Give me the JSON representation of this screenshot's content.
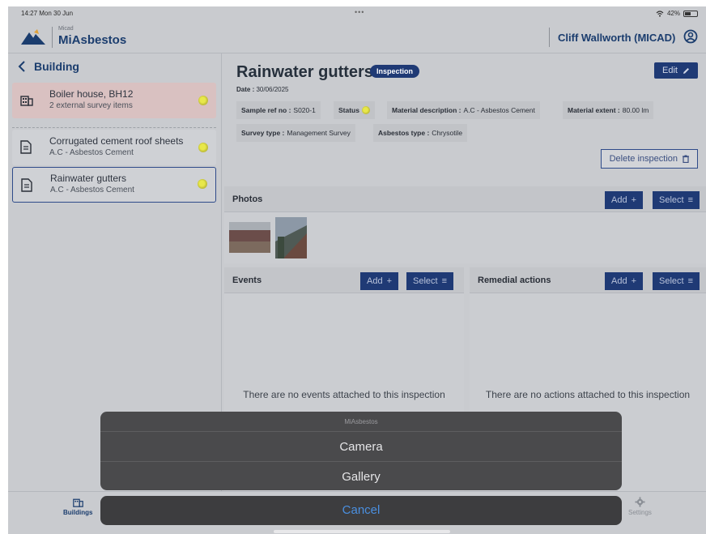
{
  "status_bar": {
    "time": "14:27  Mon 30 Jun",
    "dots": "•••",
    "battery": "42%"
  },
  "header": {
    "logo_small": "Micad",
    "logo_name": "MiAsbestos",
    "user_name": "Cliff Wallworth (MICAD)"
  },
  "sidebar": {
    "back_title": "Building",
    "items": [
      {
        "title": "Boiler house, BH12",
        "subtitle": "2 external survey items",
        "icon": "building-icon"
      },
      {
        "title": "Corrugated cement roof sheets",
        "subtitle": "A.C - Asbestos Cement",
        "icon": "document-icon"
      },
      {
        "title": "Rainwater gutters",
        "subtitle": "A.C - Asbestos Cement",
        "icon": "document-icon"
      }
    ]
  },
  "main": {
    "title": "Rainwater gutters",
    "badge": "Inspection",
    "edit_label": "Edit",
    "date_label": "Date :",
    "date_value": "30/06/2025",
    "sample_ref_label": "Sample ref no :",
    "sample_ref_value": "S020-1",
    "status_label": "Status",
    "material_desc_label": "Material description :",
    "material_desc_value": "A.C - Asbestos Cement",
    "material_extent_label": "Material extent :",
    "material_extent_value": "80.00 lm",
    "survey_type_label": "Survey type :",
    "survey_type_value": "Management Survey",
    "asbestos_type_label": "Asbestos type :",
    "asbestos_type_value": "Chrysotile",
    "delete_label": "Delete inspection",
    "photos": {
      "title": "Photos",
      "add_label": "Add",
      "select_label": "Select"
    },
    "events": {
      "title": "Events",
      "add_label": "Add",
      "select_label": "Select",
      "empty": "There are no events attached to this inspection"
    },
    "remedial": {
      "title": "Remedial actions",
      "add_label": "Add",
      "select_label": "Select",
      "empty": "There are no actions attached to this inspection"
    }
  },
  "tabbar": {
    "buildings": "Buildings",
    "settings": "Settings"
  },
  "action_sheet": {
    "title": "MiAsbestos",
    "camera": "Camera",
    "gallery": "Gallery",
    "cancel": "Cancel"
  },
  "colors": {
    "accent": "#1f3a75",
    "status_dot": "#e0e03a",
    "cancel_text": "#4a8fe0"
  }
}
